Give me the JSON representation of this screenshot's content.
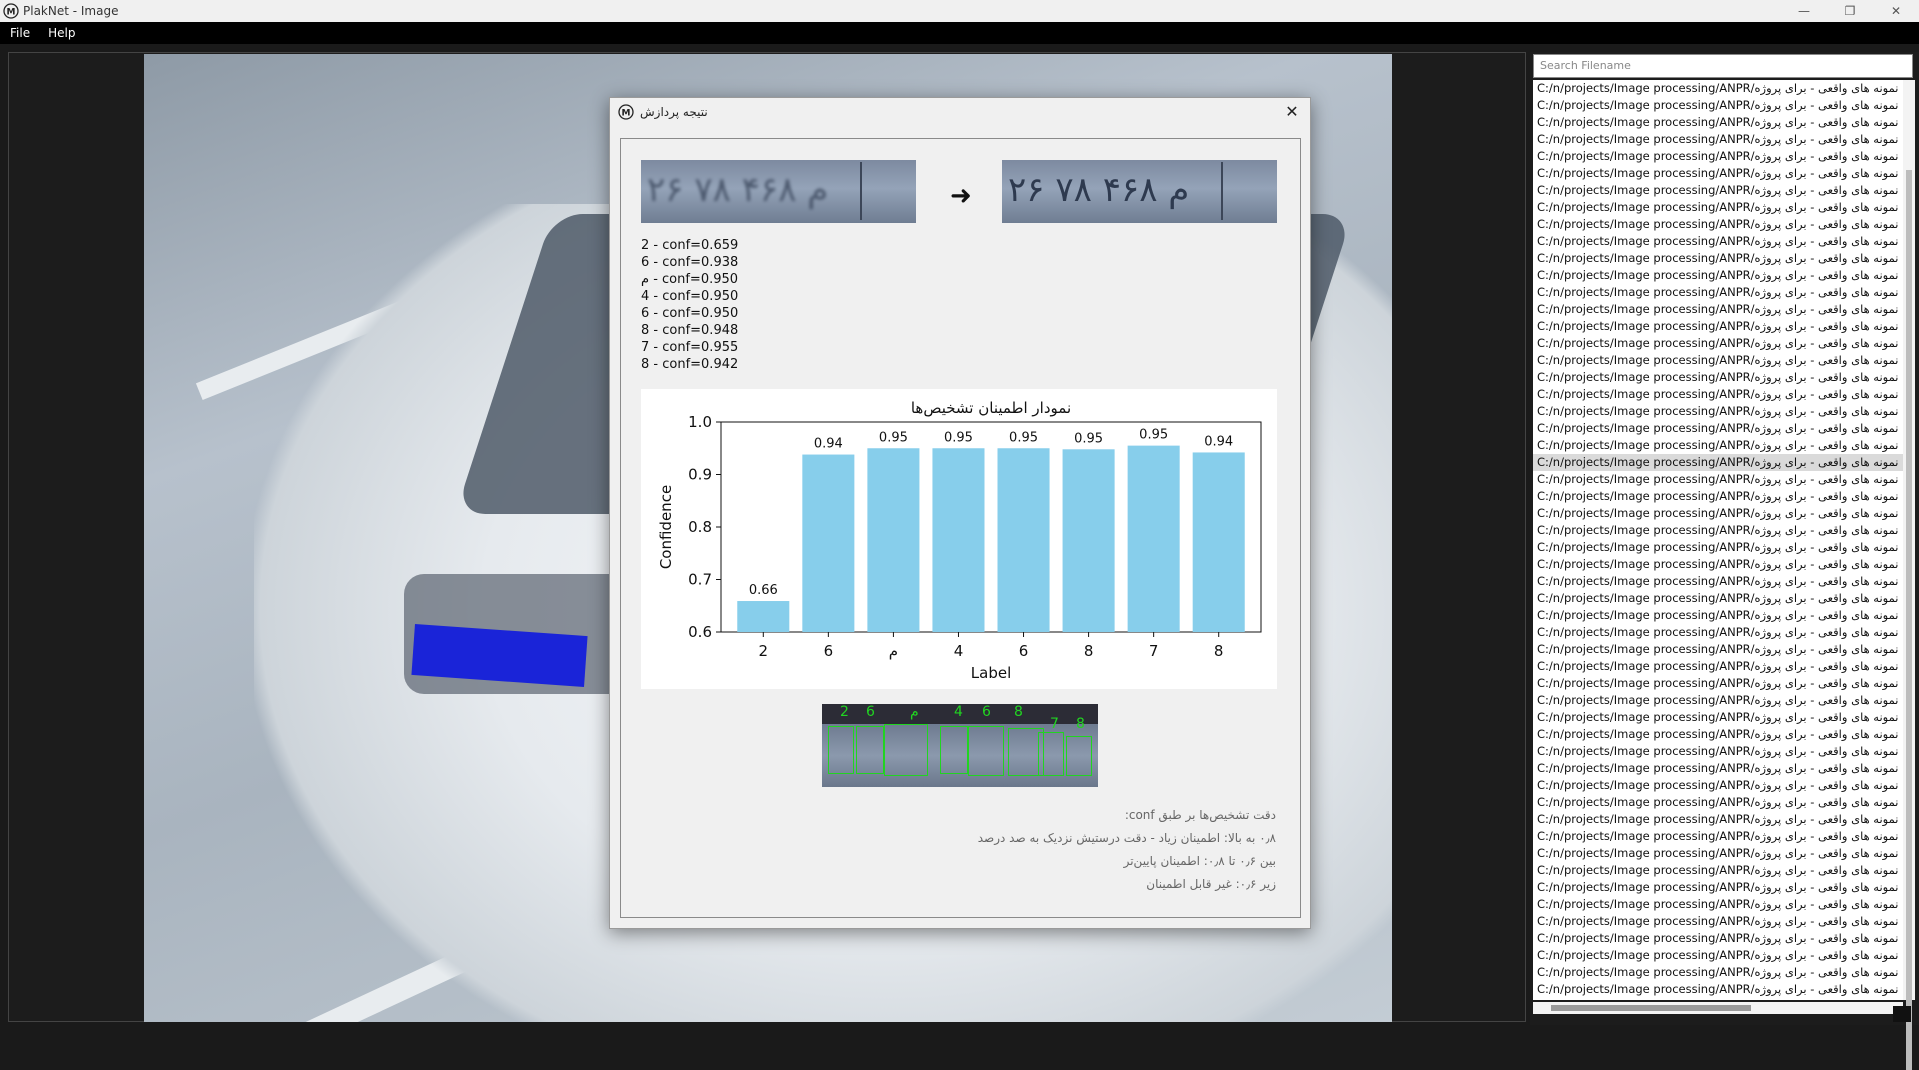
{
  "window": {
    "title": "PlakNet - Image",
    "controls": [
      "minimize",
      "restore",
      "close"
    ]
  },
  "menu": {
    "file": "File",
    "help": "Help"
  },
  "sidebar": {
    "search_placeholder": "Search Filename",
    "files": [
      "C:/n/projects/Image processing/ANPR/نمونه های واقعی - برای پروژه",
      "C:/n/projects/Image processing/ANPR/نمونه های واقعی - برای پروژه",
      "C:/n/projects/Image processing/ANPR/نمونه های واقعی - برای پروژه",
      "C:/n/projects/Image processing/ANPR/نمونه های واقعی - برای پروژه",
      "C:/n/projects/Image processing/ANPR/نمونه های واقعی - برای پروژه",
      "C:/n/projects/Image processing/ANPR/نمونه های واقعی - برای پروژه",
      "C:/n/projects/Image processing/ANPR/نمونه های واقعی - برای پروژه",
      "C:/n/projects/Image processing/ANPR/نمونه های واقعی - برای پروژه",
      "C:/n/projects/Image processing/ANPR/نمونه های واقعی - برای پروژه",
      "C:/n/projects/Image processing/ANPR/نمونه های واقعی - برای پروژه",
      "C:/n/projects/Image processing/ANPR/نمونه های واقعی - برای پروژه",
      "C:/n/projects/Image processing/ANPR/نمونه های واقعی - برای پروژه",
      "C:/n/projects/Image processing/ANPR/نمونه های واقعی - برای پروژه",
      "C:/n/projects/Image processing/ANPR/نمونه های واقعی - برای پروژه",
      "C:/n/projects/Image processing/ANPR/نمونه های واقعی - برای پروژه",
      "C:/n/projects/Image processing/ANPR/نمونه های واقعی - برای پروژه",
      "C:/n/projects/Image processing/ANPR/نمونه های واقعی - برای پروژه",
      "C:/n/projects/Image processing/ANPR/نمونه های واقعی - برای پروژه",
      "C:/n/projects/Image processing/ANPR/نمونه های واقعی - برای پروژه",
      "C:/n/projects/Image processing/ANPR/نمونه های واقعی - برای پروژه",
      "C:/n/projects/Image processing/ANPR/نمونه های واقعی - برای پروژه",
      "C:/n/projects/Image processing/ANPR/نمونه های واقعی - برای پروژه",
      "C:/n/projects/Image processing/ANPR/نمونه های واقعی - برای پروژه",
      "C:/n/projects/Image processing/ANPR/نمونه های واقعی - برای پروژه",
      "C:/n/projects/Image processing/ANPR/نمونه های واقعی - برای پروژه",
      "C:/n/projects/Image processing/ANPR/نمونه های واقعی - برای پروژه",
      "C:/n/projects/Image processing/ANPR/نمونه های واقعی - برای پروژه",
      "C:/n/projects/Image processing/ANPR/نمونه های واقعی - برای پروژه",
      "C:/n/projects/Image processing/ANPR/نمونه های واقعی - برای پروژه",
      "C:/n/projects/Image processing/ANPR/نمونه های واقعی - برای پروژه",
      "C:/n/projects/Image processing/ANPR/نمونه های واقعی - برای پروژه",
      "C:/n/projects/Image processing/ANPR/نمونه های واقعی - برای پروژه",
      "C:/n/projects/Image processing/ANPR/نمونه های واقعی - برای پروژه",
      "C:/n/projects/Image processing/ANPR/نمونه های واقعی - برای پروژه",
      "C:/n/projects/Image processing/ANPR/نمونه های واقعی - برای پروژه",
      "C:/n/projects/Image processing/ANPR/نمونه های واقعی - برای پروژه",
      "C:/n/projects/Image processing/ANPR/نمونه های واقعی - برای پروژه",
      "C:/n/projects/Image processing/ANPR/نمونه های واقعی - برای پروژه",
      "C:/n/projects/Image processing/ANPR/نمونه های واقعی - برای پروژه",
      "C:/n/projects/Image processing/ANPR/نمونه های واقعی - برای پروژه",
      "C:/n/projects/Image processing/ANPR/نمونه های واقعی - برای پروژه",
      "C:/n/projects/Image processing/ANPR/نمونه های واقعی - برای پروژه",
      "C:/n/projects/Image processing/ANPR/نمونه های واقعی - برای پروژه",
      "C:/n/projects/Image processing/ANPR/نمونه های واقعی - برای پروژه",
      "C:/n/projects/Image processing/ANPR/نمونه های واقعی - برای پروژه",
      "C:/n/projects/Image processing/ANPR/نمونه های واقعی - برای پروژه",
      "C:/n/projects/Image processing/ANPR/نمونه های واقعی - برای پروژه",
      "C:/n/projects/Image processing/ANPR/نمونه های واقعی - برای پروژه",
      "C:/n/projects/Image processing/ANPR/نمونه های واقعی - برای پروژه",
      "C:/n/projects/Image processing/ANPR/نمونه های واقعی - برای پروژه",
      "C:/n/projects/Image processing/ANPR/نمونه های واقعی - برای پروژه",
      "C:/n/projects/Image processing/ANPR/نمونه های واقعی - برای پروژه",
      "C:/n/projects/Image processing/ANPR/نمونه های واقعی - برای پروژه",
      "C:/n/projects/Image processing/ANPR/نمونه های واقعی - برای پروژه"
    ],
    "selected_index": 22
  },
  "dialog": {
    "title": "نتیجه پردازش",
    "plate_before_text": "۲۶ م ۴۶۸ ۷۸",
    "plate_after_text": "۲۶ م ۴۶۸ ۷۸",
    "arrow": "➜",
    "confidences": [
      "2 - conf=0.659",
      "6 - conf=0.938",
      "م - conf=0.950",
      "4 - conf=0.950",
      "6 - conf=0.950",
      "8 - conf=0.948",
      "7 - conf=0.955",
      "8 - conf=0.942"
    ],
    "crop_labels": [
      "2",
      "6",
      "م",
      "4",
      "6",
      "8",
      "7",
      "8"
    ],
    "legend": [
      "دقت تشخیص‌ها بر طبق conf:",
      "۰٫۸ به بالا: اطمینان زیاد - دقت درستیش نزدیک به صد درصد",
      "بین ۰٫۶ تا ۰٫۸: اطمینان پایین‌تر",
      "زیر ۰٫۶: غیر قابل اطمینان"
    ]
  },
  "chart_data": {
    "type": "bar",
    "title": "نمودار اطمینان تشخیص‌ها",
    "xlabel": "Label",
    "ylabel": "Confidence",
    "categories": [
      "2",
      "6",
      "م",
      "4",
      "6",
      "8",
      "7",
      "8"
    ],
    "values": [
      0.659,
      0.938,
      0.95,
      0.95,
      0.95,
      0.948,
      0.955,
      0.942
    ],
    "data_labels": [
      "0.66",
      "0.94",
      "0.95",
      "0.95",
      "0.95",
      "0.95",
      "0.95",
      "0.94"
    ],
    "ylim": [
      0.6,
      1.0
    ],
    "yticks": [
      "0.6",
      "0.7",
      "0.8",
      "0.9",
      "1.0"
    ],
    "bar_color": "#87ceeb",
    "grid": false
  }
}
